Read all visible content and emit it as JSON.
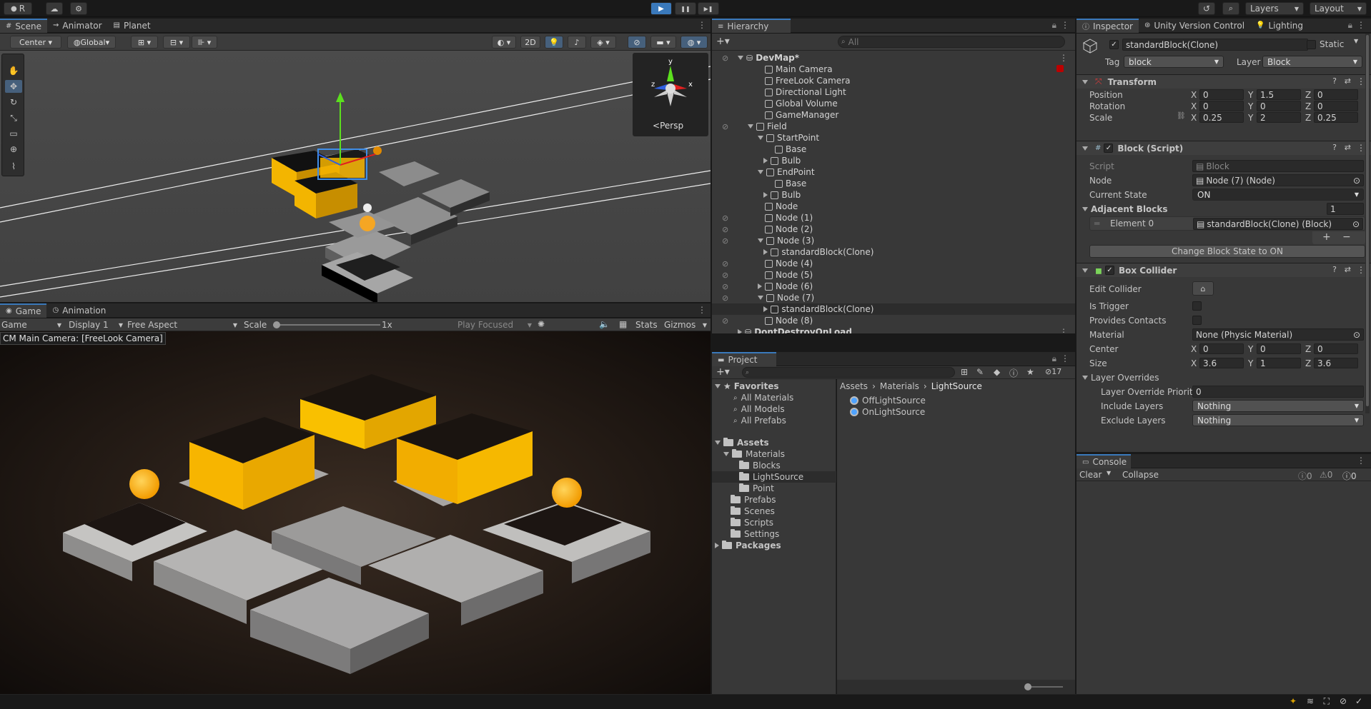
{
  "topbar": {
    "account": "R",
    "play": "▶",
    "pause": "❚❚",
    "step": "▶❚",
    "layers": "Layers",
    "layout": "Layout"
  },
  "scene": {
    "tabs": [
      "Scene",
      "Animator",
      "Planet"
    ],
    "pivot": "Center",
    "space": "Global",
    "mode2d": "2D",
    "persp": "Persp"
  },
  "game": {
    "tabs": [
      "Game",
      "Animation"
    ],
    "view": "Game",
    "display": "Display 1",
    "aspect": "Free Aspect",
    "scale_label": "Scale",
    "scale_value": "1x",
    "play_focused": "Play Focused",
    "stats": "Stats",
    "gizmos": "Gizmos",
    "camera_label": "CM Main Camera: [FreeLook Camera]"
  },
  "hierarchy": {
    "title": "Hierarchy",
    "search_placeholder": "All",
    "items": [
      {
        "label": "DevMap*",
        "indent": 0,
        "type": "scene",
        "exp": "d",
        "eye": true
      },
      {
        "label": "Main Camera",
        "indent": 2,
        "type": "go"
      },
      {
        "label": "FreeLook Camera",
        "indent": 2,
        "type": "go"
      },
      {
        "label": "Directional Light",
        "indent": 2,
        "type": "go"
      },
      {
        "label": "Global Volume",
        "indent": 2,
        "type": "go"
      },
      {
        "label": "GameManager",
        "indent": 2,
        "type": "go"
      },
      {
        "label": "Field",
        "indent": 1,
        "type": "go",
        "exp": "d",
        "eye": true
      },
      {
        "label": "StartPoint",
        "indent": 2,
        "type": "go",
        "exp": "d"
      },
      {
        "label": "Base",
        "indent": 3,
        "type": "go"
      },
      {
        "label": "Bulb",
        "indent": 2.6,
        "type": "go",
        "exp": "r"
      },
      {
        "label": "EndPoint",
        "indent": 2,
        "type": "go",
        "exp": "d"
      },
      {
        "label": "Base",
        "indent": 3,
        "type": "go"
      },
      {
        "label": "Bulb",
        "indent": 2.6,
        "type": "go",
        "exp": "r"
      },
      {
        "label": "Node",
        "indent": 2,
        "type": "go"
      },
      {
        "label": "Node (1)",
        "indent": 2,
        "type": "go",
        "eye": true
      },
      {
        "label": "Node (2)",
        "indent": 2,
        "type": "go",
        "eye": true
      },
      {
        "label": "Node (3)",
        "indent": 2,
        "type": "go",
        "exp": "d",
        "eye": true
      },
      {
        "label": "standardBlock(Clone)",
        "indent": 2.6,
        "type": "go",
        "exp": "r"
      },
      {
        "label": "Node (4)",
        "indent": 2,
        "type": "go",
        "eye": true
      },
      {
        "label": "Node (5)",
        "indent": 2,
        "type": "go",
        "eye": true
      },
      {
        "label": "Node (6)",
        "indent": 2,
        "type": "go",
        "exp": "r",
        "eye": true
      },
      {
        "label": "Node (7)",
        "indent": 2,
        "type": "go",
        "exp": "d",
        "eye": true
      },
      {
        "label": "standardBlock(Clone)",
        "indent": 2.6,
        "type": "go",
        "exp": "r",
        "sel": true
      },
      {
        "label": "Node (8)",
        "indent": 2,
        "type": "go",
        "eye": true
      },
      {
        "label": "DontDestroyOnLoad",
        "indent": 0,
        "type": "scene",
        "exp": "r"
      }
    ]
  },
  "project": {
    "title": "Project",
    "count": "17",
    "favorites": "Favorites",
    "fav_items": [
      "All Materials",
      "All Models",
      "All Prefabs"
    ],
    "assets": "Assets",
    "tree": [
      {
        "label": "Materials",
        "indent": 1,
        "exp": true
      },
      {
        "label": "Blocks",
        "indent": 2
      },
      {
        "label": "LightSource",
        "indent": 2,
        "sel": true
      },
      {
        "label": "Point",
        "indent": 2
      },
      {
        "label": "Prefabs",
        "indent": 1
      },
      {
        "label": "Scenes",
        "indent": 1
      },
      {
        "label": "Scripts",
        "indent": 1
      },
      {
        "label": "Settings",
        "indent": 1
      }
    ],
    "packages": "Packages",
    "breadcrumb": [
      "Assets",
      "Materials",
      "LightSource"
    ],
    "files": [
      "OffLightSource",
      "OnLightSource"
    ]
  },
  "inspector": {
    "tabs": [
      "Inspector",
      "Unity Version Control",
      "Lighting"
    ],
    "object_name": "standardBlock(Clone)",
    "static": "Static",
    "tag_label": "Tag",
    "tag": "block",
    "layer_label": "Layer",
    "layer": "Block",
    "transform": {
      "title": "Transform",
      "rows": [
        {
          "label": "Position",
          "x": "0",
          "y": "1.5",
          "z": "0"
        },
        {
          "label": "Rotation",
          "x": "0",
          "y": "0",
          "z": "0"
        },
        {
          "label": "Scale",
          "x": "0.25",
          "y": "2",
          "z": "0.25"
        }
      ]
    },
    "block": {
      "title": "Block (Script)",
      "script_label": "Script",
      "script": "Block",
      "node_label": "Node",
      "node": "Node (7) (Node)",
      "state_label": "Current State",
      "state": "ON",
      "adj_label": "Adjacent Blocks",
      "adj_count": "1",
      "element_label": "Element 0",
      "element": "standardBlock(Clone) (Block)",
      "button": "Change Block State to ON"
    },
    "collider": {
      "title": "Box Collider",
      "edit_label": "Edit Collider",
      "trigger_label": "Is Trigger",
      "contacts_label": "Provides Contacts",
      "material_label": "Material",
      "material": "None (Physic Material)",
      "center_label": "Center",
      "center": {
        "x": "0",
        "y": "0",
        "z": "0"
      },
      "size_label": "Size",
      "size": {
        "x": "3.6",
        "y": "1",
        "z": "3.6"
      },
      "overrides_label": "Layer Overrides",
      "priority_label": "Layer Override Priority",
      "priority": "0",
      "include_label": "Include Layers",
      "include": "Nothing",
      "exclude_label": "Exclude Layers",
      "exclude": "Nothing"
    }
  },
  "console": {
    "title": "Console",
    "clear": "Clear",
    "collapse": "Collapse",
    "info": "0",
    "warn": "0",
    "err": "0"
  },
  "colors": {
    "accent": "#3a79bb",
    "yellow": "#f7b500",
    "panel": "#383838"
  }
}
